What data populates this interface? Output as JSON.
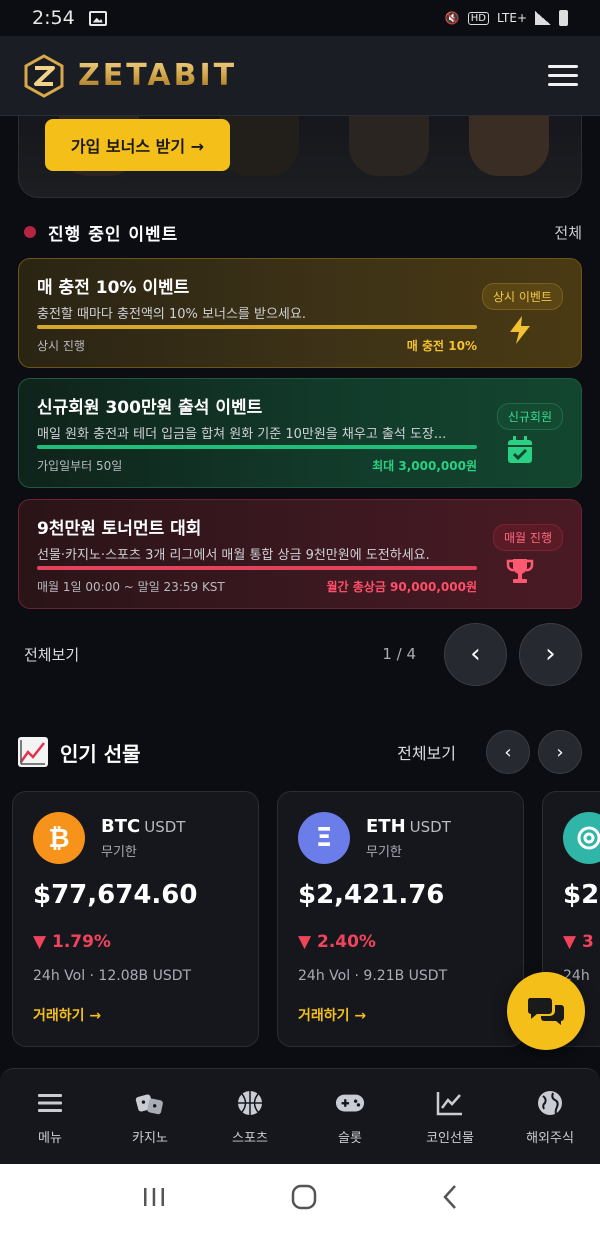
{
  "status": {
    "time": "2:54",
    "network": "LTE+",
    "hd": "HD"
  },
  "header": {
    "brand": "ZETABIT"
  },
  "hero": {
    "bonus_button": "가입 보너스 받기 →"
  },
  "events_section": {
    "title": "진행 중인 이벤트",
    "all_link": "전체"
  },
  "events": [
    {
      "title": "매 충전 10% 이벤트",
      "desc": "충전할 때마다 충전액의 10% 보너스를 받으세요.",
      "period": "상시 진행",
      "value": "매 충전 10%",
      "badge": "상시 이벤트",
      "icon": "lightning-icon"
    },
    {
      "title": "신규회원 300만원 출석 이벤트",
      "desc": "매일 원화 충전과 테더 입금을 합쳐 원화 기준 10만원을 채우고 출석 도장...",
      "period": "가입일부터 50일",
      "value": "최대 3,000,000원",
      "badge": "신규회원",
      "icon": "calendar-check-icon"
    },
    {
      "title": "9천만원 토너먼트 대회",
      "desc": "선물·카지노·스포츠 3개 리그에서 매월 통합 상금 9천만원에 도전하세요.",
      "period": "매월 1일 00:00 ~ 말일 23:59 KST",
      "value": "월간 총상금 90,000,000원",
      "badge": "매월 진행",
      "icon": "trophy-icon"
    }
  ],
  "pager": {
    "all": "전체보기",
    "count": "1 / 4",
    "prev": "‹",
    "next": "›"
  },
  "futures": {
    "title": "인기 선물",
    "all": "전체보기",
    "prev": "‹",
    "next": "›"
  },
  "coins": [
    {
      "icon_letter": "₿",
      "color": "#f7931a",
      "symbol": "BTC",
      "quote": "USDT",
      "kind": "무기한",
      "price": "$77,674.60",
      "change": "▼ 1.79%",
      "volume": "24h Vol · 12.08B USDT",
      "trade": "거래하기 →"
    },
    {
      "icon_letter": "Ξ",
      "color": "#6b7de8",
      "symbol": "ETH",
      "quote": "USDT",
      "kind": "무기한",
      "price": "$2,421.76",
      "change": "▼ 2.40%",
      "volume": "24h Vol · 9.21B USDT",
      "trade": "거래하기 →"
    },
    {
      "icon_letter": "",
      "color": "#2fb6a8",
      "price": "$2",
      "change": "▼ 3",
      "volume": "24h"
    }
  ],
  "bottom_nav": [
    {
      "label": "메뉴",
      "icon": "menu-icon"
    },
    {
      "label": "카지노",
      "icon": "dice-icon"
    },
    {
      "label": "스포츠",
      "icon": "basketball-icon"
    },
    {
      "label": "슬롯",
      "icon": "gamepad-icon"
    },
    {
      "label": "코인선물",
      "icon": "chart-line-icon"
    },
    {
      "label": "해외주식",
      "icon": "globe-icon"
    }
  ],
  "colors": {
    "accent": "#f5bf1a",
    "down": "#f0435c",
    "green": "#1fbf7a"
  }
}
